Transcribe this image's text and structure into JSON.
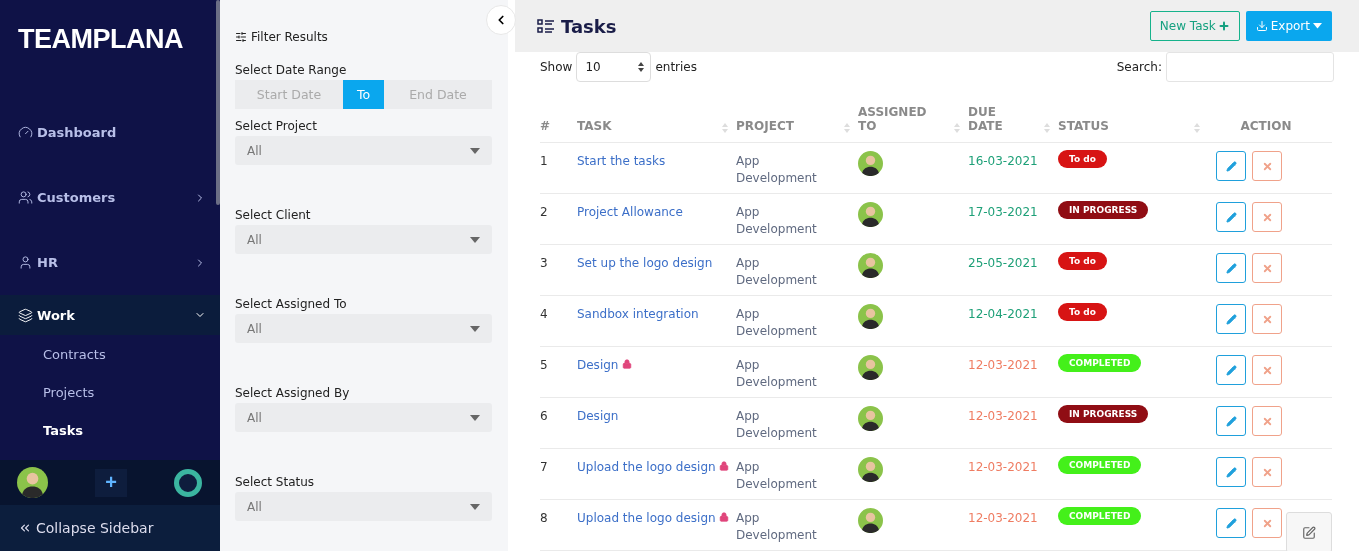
{
  "brand": "TEAMPLANA",
  "nav": [
    {
      "label": "Dashboard",
      "expanded": false,
      "selected": false,
      "has_children": false
    },
    {
      "label": "Customers",
      "expanded": false,
      "selected": false,
      "has_children": true
    },
    {
      "label": "HR",
      "expanded": false,
      "selected": false,
      "has_children": true
    },
    {
      "label": "Work",
      "expanded": true,
      "selected": true,
      "has_children": true,
      "children": [
        {
          "label": "Contracts",
          "selected": false
        },
        {
          "label": "Projects",
          "selected": false
        },
        {
          "label": "Tasks",
          "selected": true
        }
      ]
    }
  ],
  "collapse_label": "Collapse Sidebar",
  "add_symbol": "+",
  "filter": {
    "title": "Filter Results",
    "date_label": "Select Date Range",
    "date_range": [
      {
        "label": "Start Date",
        "selected": false
      },
      {
        "label": "To",
        "selected": true
      },
      {
        "label": "End Date",
        "selected": false
      }
    ],
    "selects": [
      {
        "label": "Select Project",
        "value": "All"
      },
      {
        "label": "Select Client",
        "value": "All"
      },
      {
        "label": "Select Assigned To",
        "value": "All"
      },
      {
        "label": "Select Assigned By",
        "value": "All"
      },
      {
        "label": "Select Status",
        "value": "All"
      }
    ]
  },
  "page_title": "Tasks",
  "new_task_label": "New Task",
  "export_label": "Export",
  "show_label": "Show",
  "entries_value": "10",
  "entries_label": "entries",
  "search_label": "Search:",
  "columns": [
    {
      "label": "#",
      "sortable": false
    },
    {
      "label": "TASK",
      "sortable": true
    },
    {
      "label": "PROJECT",
      "sortable": true
    },
    {
      "label": "ASSIGNED TO",
      "sortable": true
    },
    {
      "label": "DUE DATE",
      "sortable": true
    },
    {
      "label": "STATUS",
      "sortable": true
    },
    {
      "label": "ACTION",
      "sortable": false
    }
  ],
  "rows": [
    {
      "num": "1",
      "task": "Start the tasks",
      "locked": false,
      "project": "App Development",
      "due": "16-03-2021",
      "overdue": false,
      "status": "To do",
      "kind": "todo"
    },
    {
      "num": "2",
      "task": "Project Allowance",
      "locked": false,
      "project": "App Development",
      "due": "17-03-2021",
      "overdue": false,
      "status": "IN PROGRESS",
      "kind": "progress"
    },
    {
      "num": "3",
      "task": "Set up the logo design",
      "locked": false,
      "project": "App Development",
      "due": "25-05-2021",
      "overdue": false,
      "status": "To do",
      "kind": "todo"
    },
    {
      "num": "4",
      "task": "Sandbox integration",
      "locked": false,
      "project": "App Development",
      "due": "12-04-2021",
      "overdue": false,
      "status": "To do",
      "kind": "todo"
    },
    {
      "num": "5",
      "task": "Design",
      "locked": true,
      "project": "App Development",
      "due": "12-03-2021",
      "overdue": true,
      "status": "COMPLETED",
      "kind": "completed"
    },
    {
      "num": "6",
      "task": "Design",
      "locked": false,
      "project": "App Development",
      "due": "12-03-2021",
      "overdue": true,
      "status": "IN PROGRESS",
      "kind": "progress"
    },
    {
      "num": "7",
      "task": "Upload the logo design",
      "locked": true,
      "project": "App Development",
      "due": "12-03-2021",
      "overdue": true,
      "status": "COMPLETED",
      "kind": "completed"
    },
    {
      "num": "8",
      "task": "Upload the logo design",
      "locked": true,
      "project": "App Development",
      "due": "12-03-2021",
      "overdue": true,
      "status": "COMPLETED",
      "kind": "completed"
    }
  ]
}
